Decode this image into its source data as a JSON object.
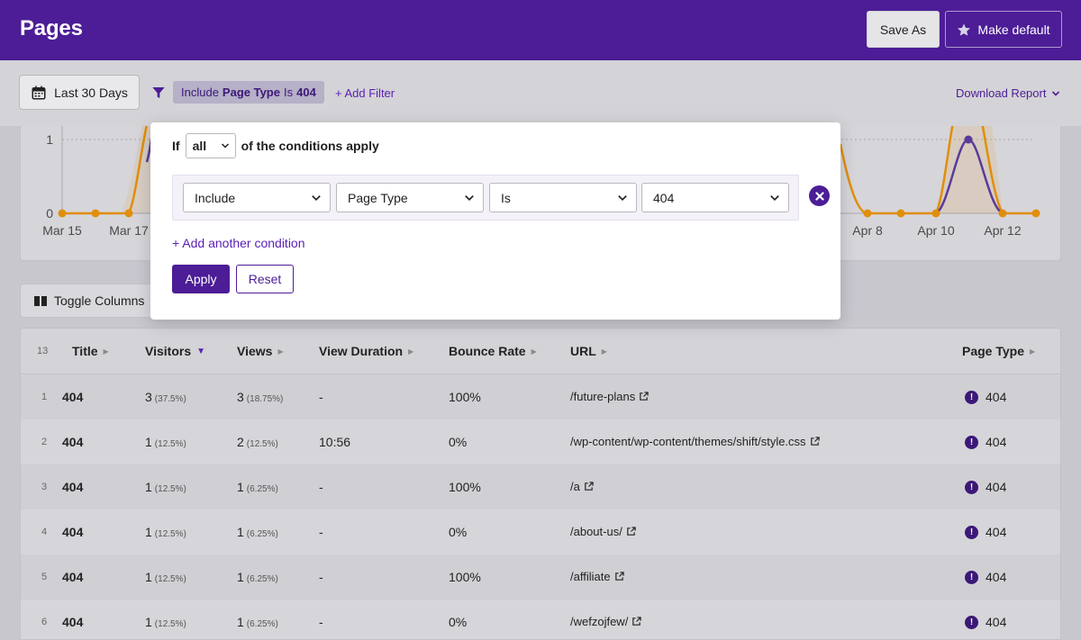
{
  "header": {
    "title": "Pages",
    "save_as_label": "Save As",
    "make_default_label": "Make default"
  },
  "filterbar": {
    "date_range_label": "Last 30 Days",
    "chip": {
      "mode": "Include",
      "field": "Page Type",
      "op": "Is",
      "value": "404"
    },
    "add_filter_label": "+ Add Filter",
    "download_label": "Download Report"
  },
  "chart_data": {
    "type": "line",
    "y_ticks": [
      "0",
      "1"
    ],
    "x_tick_labels": [
      "Mar 15",
      "Mar 17",
      "Apr 8",
      "Apr 10",
      "Apr 12"
    ],
    "series": [
      {
        "color": "#e08e0b"
      },
      {
        "color": "#5b3a9b"
      }
    ],
    "colors": {
      "visitors_line": "#e08e0b",
      "views_line": "#5b3a9b"
    }
  },
  "filter_modal": {
    "if_label": "If",
    "match_value": "all",
    "conditions_label": "of the conditions apply",
    "condition": {
      "mode": "Include",
      "field": "Page Type",
      "op": "Is",
      "value": "404"
    },
    "add_condition_label": "+ Add another condition",
    "apply_label": "Apply",
    "reset_label": "Reset"
  },
  "toggle_columns_label": "Toggle Columns",
  "table": {
    "row_count": "13",
    "columns": [
      "Title",
      "Visitors",
      "Views",
      "View Duration",
      "Bounce Rate",
      "URL",
      "Page Type"
    ],
    "rows": [
      {
        "index": "1",
        "title": "404",
        "visitors": "3",
        "visitors_pct": "(37.5%)",
        "views": "3",
        "views_pct": "(18.75%)",
        "duration": "-",
        "bounce": "100%",
        "url": "/future-plans",
        "page_type": "404"
      },
      {
        "index": "2",
        "title": "404",
        "visitors": "1",
        "visitors_pct": "(12.5%)",
        "views": "2",
        "views_pct": "(12.5%)",
        "duration": "10:56",
        "bounce": "0%",
        "url": "/wp-content/wp-content/themes/shift/style.css",
        "page_type": "404"
      },
      {
        "index": "3",
        "title": "404",
        "visitors": "1",
        "visitors_pct": "(12.5%)",
        "views": "1",
        "views_pct": "(6.25%)",
        "duration": "-",
        "bounce": "100%",
        "url": "/a",
        "page_type": "404"
      },
      {
        "index": "4",
        "title": "404",
        "visitors": "1",
        "visitors_pct": "(12.5%)",
        "views": "1",
        "views_pct": "(6.25%)",
        "duration": "-",
        "bounce": "0%",
        "url": "/about-us/",
        "page_type": "404"
      },
      {
        "index": "5",
        "title": "404",
        "visitors": "1",
        "visitors_pct": "(12.5%)",
        "views": "1",
        "views_pct": "(6.25%)",
        "duration": "-",
        "bounce": "100%",
        "url": "/affiliate",
        "page_type": "404"
      },
      {
        "index": "6",
        "title": "404",
        "visitors": "1",
        "visitors_pct": "(12.5%)",
        "views": "1",
        "views_pct": "(6.25%)",
        "duration": "-",
        "bounce": "0%",
        "url": "/wefzojfew/",
        "page_type": "404"
      }
    ]
  }
}
